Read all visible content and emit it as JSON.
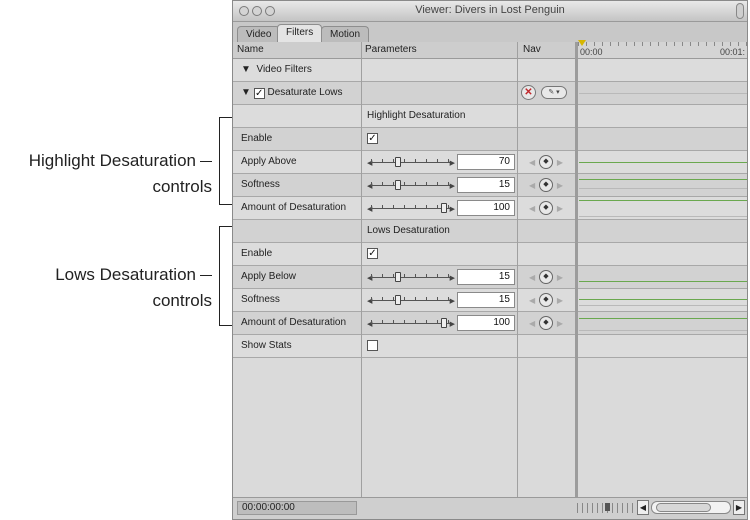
{
  "callouts": {
    "highlight": {
      "line1": "Highlight Desaturation",
      "line2": "controls"
    },
    "lows": {
      "line1": "Lows Desaturation",
      "line2": "controls"
    }
  },
  "window": {
    "title": "Viewer: Divers in Lost Penguin",
    "tabs": [
      "Video",
      "Filters",
      "Motion"
    ],
    "active_tab": "Filters"
  },
  "columns": {
    "name": "Name",
    "parameters": "Parameters",
    "nav": "Nav"
  },
  "ruler": {
    "start": "00:00",
    "end": "00:01:"
  },
  "rows": {
    "video_filters": "Video Filters",
    "effect": "Desaturate Lows",
    "highlight_section": "Highlight Desaturation",
    "h_enable": "Enable",
    "h_apply_above": {
      "label": "Apply Above",
      "value": "70",
      "level": 0.3
    },
    "h_softness": {
      "label": "Softness",
      "value": "15",
      "level": 0.3
    },
    "h_amount": {
      "label": "Amount of Desaturation",
      "value": "100",
      "level": 1.0
    },
    "lows_section": "Lows Desaturation",
    "l_enable": "Enable",
    "l_apply_below": {
      "label": "Apply Below",
      "value": "15",
      "level": 0.3
    },
    "l_softness": {
      "label": "Softness",
      "value": "15",
      "level": 0.3
    },
    "l_amount": {
      "label": "Amount of Desaturation",
      "value": "100",
      "level": 1.0
    },
    "show_stats": "Show Stats"
  },
  "footer": {
    "timecode": "00:00:00:00"
  },
  "colors": {
    "keyframe_line": "#6aa84f",
    "reset_red": "#c0262a",
    "playhead": "#d6b600"
  }
}
